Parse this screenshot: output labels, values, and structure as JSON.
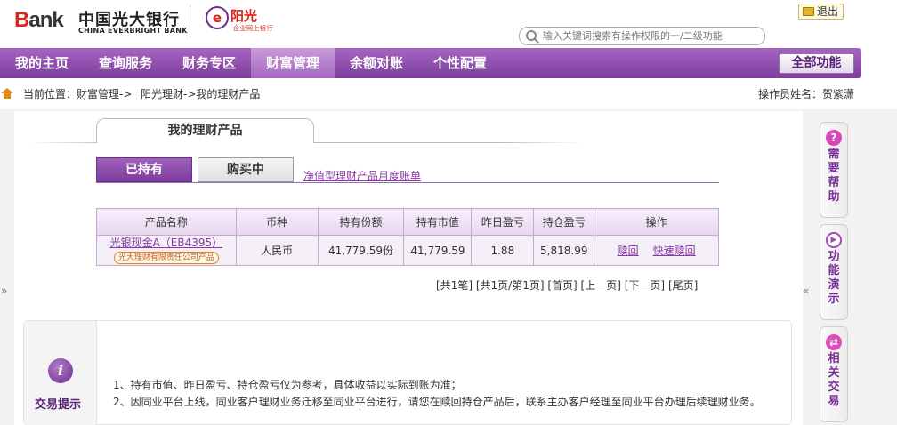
{
  "header": {
    "logo_bank": "Bank",
    "logo_cn": "中国光大银行",
    "logo_en": "CHINA EVERBRIGHT BANK",
    "emblem_text": "e",
    "sub_logo": "阳光",
    "sub_logo_sub": "企业网上银行",
    "logout_label": "退出",
    "search_placeholder": "输入关键词搜索有操作权限的一/二级功能"
  },
  "nav": {
    "items": [
      {
        "label": "我的主页"
      },
      {
        "label": "查询服务"
      },
      {
        "label": "财务专区"
      },
      {
        "label": "财富管理",
        "active": true
      },
      {
        "label": "余额对账"
      },
      {
        "label": "个性配置"
      }
    ],
    "all_functions": "全部功能"
  },
  "breadcrumb": {
    "label": "当前位置：",
    "items": [
      "财富管理->",
      "阳光理财->我的理财产品"
    ],
    "operator": "操作员姓名：贺紫潇"
  },
  "main_tab": "我的理财产品",
  "subtabs": {
    "held": "已持有",
    "buying": "购买中",
    "monthly_link": "净值型理财产品月度账单"
  },
  "table": {
    "headers": [
      "产品名称",
      "币种",
      "持有份额",
      "持有市值",
      "昨日盈亏",
      "持仓盈亏",
      "操作"
    ],
    "rows": [
      {
        "name": "光银现金A（EB4395）",
        "issuer": "光大理财有限责任公司产品",
        "currency": "人民币",
        "shares": "41,779.59份",
        "market_value": "41,779.59",
        "yesterday_pl": "1.88",
        "position_pl": "5,818.99",
        "actions": [
          "赎回",
          "快速赎回"
        ]
      }
    ]
  },
  "pager": {
    "total": "[共1笔]",
    "pages": "[共1页/第1页]",
    "first": "[首页]",
    "prev": "[上一页]",
    "next": "[下一页]",
    "last": "[尾页]"
  },
  "tips": {
    "icon": "i",
    "title": "交易提示",
    "lines": [
      "1、持有市值、昨日盈亏、持仓盈亏仅为参考，具体收益以实际到账为准；",
      "2、因同业平台上线，同业客户理财业务迁移至同业平台进行，请您在赎回持仓产品后，联系主办客户经理至同业平台办理后续理财业务。"
    ]
  },
  "side_panel": {
    "arrow_left": "»",
    "arrow_right": "«",
    "buttons": [
      {
        "icon": "?",
        "label": "需要帮助"
      },
      {
        "icon": "▶",
        "label": "功能演示"
      },
      {
        "icon": "⇄",
        "label": "相关交易"
      }
    ]
  }
}
